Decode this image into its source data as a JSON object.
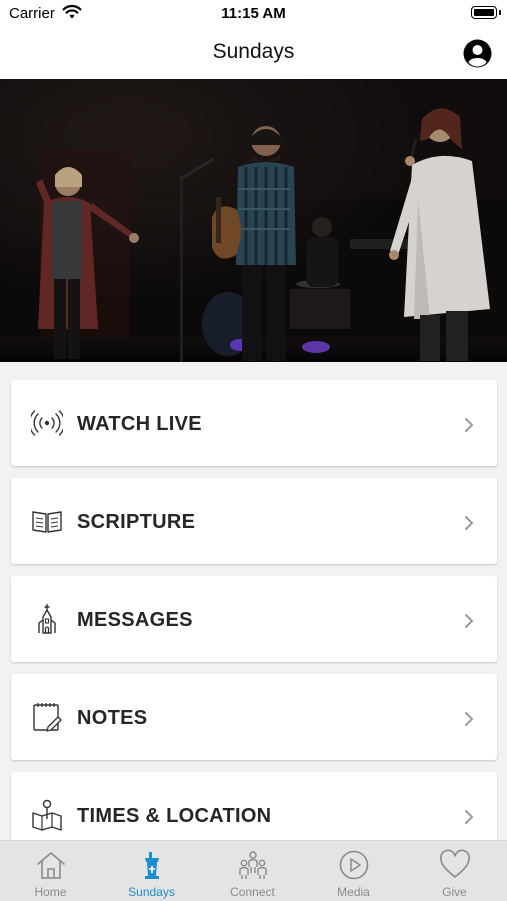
{
  "status_bar": {
    "carrier": "Carrier",
    "time": "11:15 AM"
  },
  "nav": {
    "title": "Sundays"
  },
  "menu": [
    {
      "label": "WATCH LIVE",
      "icon": "broadcast-icon"
    },
    {
      "label": "SCRIPTURE",
      "icon": "book-icon"
    },
    {
      "label": "MESSAGES",
      "icon": "church-icon"
    },
    {
      "label": "NOTES",
      "icon": "notepad-icon"
    },
    {
      "label": "TIMES & LOCATION",
      "icon": "map-pin-icon"
    }
  ],
  "tabs": [
    {
      "label": "Home",
      "icon": "home-icon",
      "active": false
    },
    {
      "label": "Sundays",
      "icon": "podium-icon",
      "active": true
    },
    {
      "label": "Connect",
      "icon": "people-icon",
      "active": false
    },
    {
      "label": "Media",
      "icon": "play-icon",
      "active": false
    },
    {
      "label": "Give",
      "icon": "heart-icon",
      "active": false
    }
  ],
  "colors": {
    "accent": "#1b8ed1",
    "tab_inactive": "#8a8a8a",
    "card_text": "#262626"
  }
}
